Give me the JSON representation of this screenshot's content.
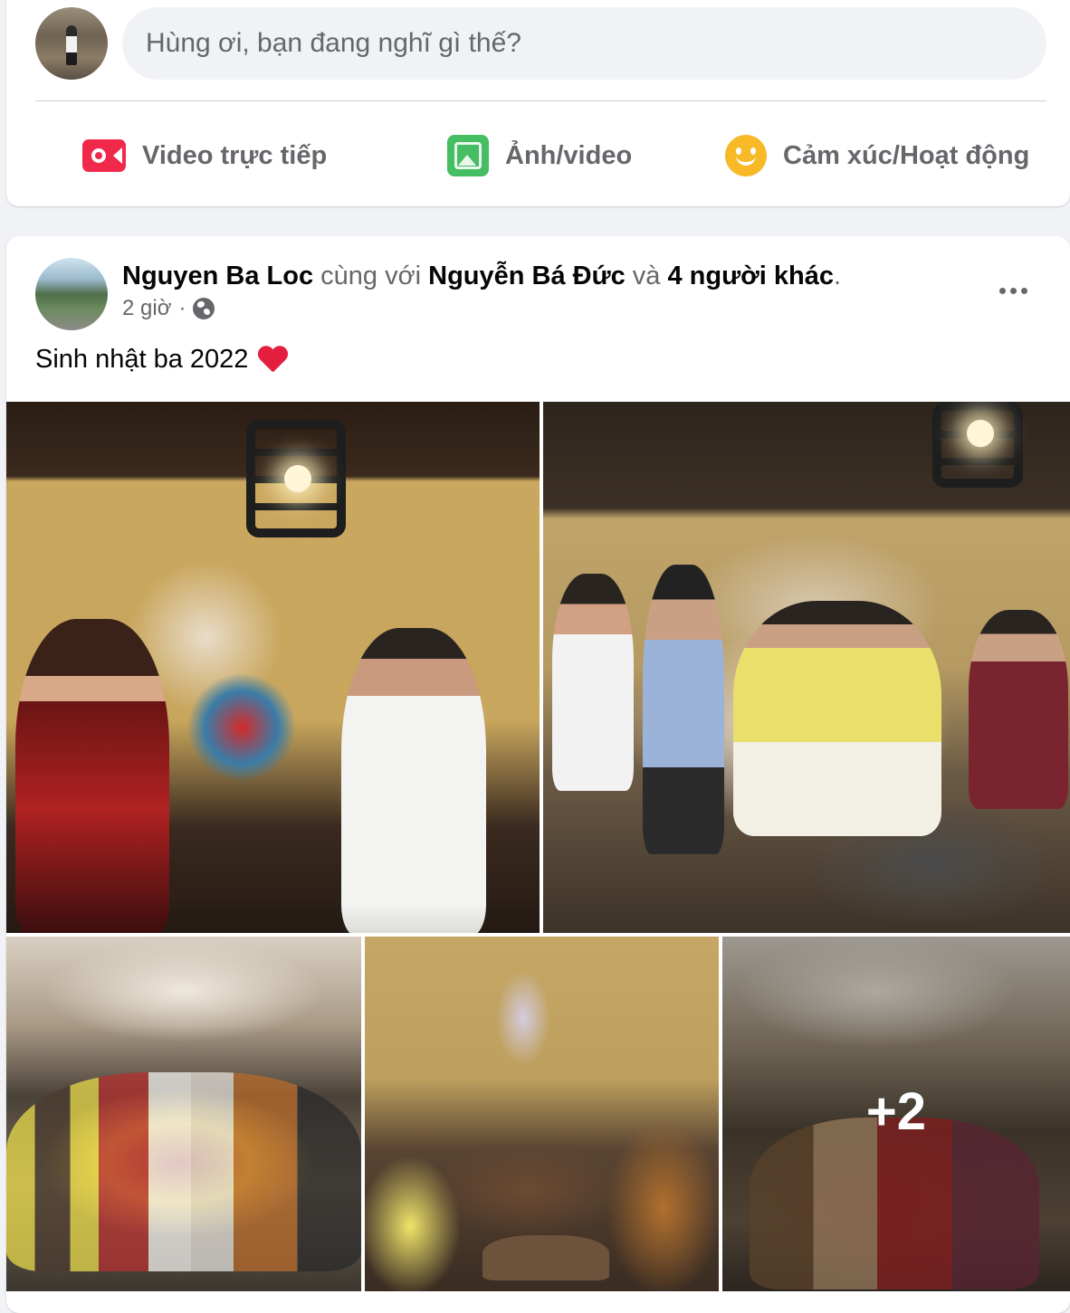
{
  "composer": {
    "placeholder": "Hùng ơi, bạn đang nghĩ gì thế?",
    "actions": [
      {
        "label": "Video trực tiếp",
        "icon": "live-video-icon",
        "color": "#f02849"
      },
      {
        "label": "Ảnh/video",
        "icon": "photo-icon",
        "color": "#45bd62"
      },
      {
        "label": "Cảm xúc/Hoạt động",
        "icon": "feeling-icon",
        "color": "#f7b928"
      }
    ]
  },
  "post": {
    "author": "Nguyen Ba Loc",
    "with_text": "cùng với",
    "tagged": "Nguyễn Bá Đức",
    "and_text": "và",
    "others": "4 người khác",
    "period": ".",
    "time": "2 giờ",
    "separator": "·",
    "privacy_icon": "globe-icon",
    "caption": "Sinh nhật ba 2022",
    "caption_emoji": "heart-icon",
    "more_photos": "+2"
  },
  "colors": {
    "background": "#f0f2f5",
    "card": "#ffffff",
    "secondary_text": "#65676b",
    "primary_text": "#050505"
  }
}
